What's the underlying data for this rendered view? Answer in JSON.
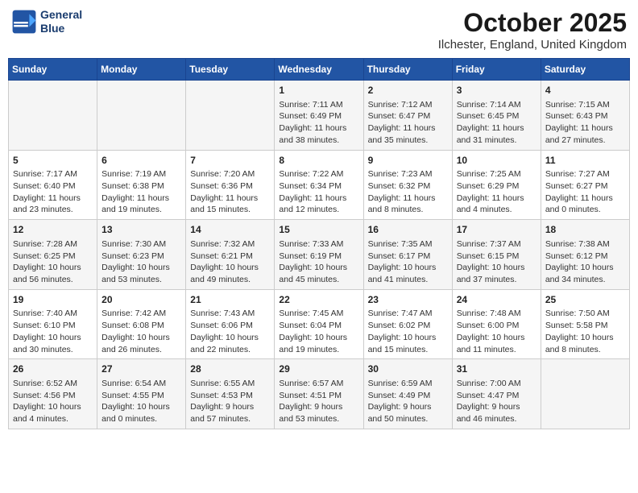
{
  "header": {
    "logo_line1": "General",
    "logo_line2": "Blue",
    "month": "October 2025",
    "location": "Ilchester, England, United Kingdom"
  },
  "weekdays": [
    "Sunday",
    "Monday",
    "Tuesday",
    "Wednesday",
    "Thursday",
    "Friday",
    "Saturday"
  ],
  "weeks": [
    [
      {
        "day": "",
        "content": ""
      },
      {
        "day": "",
        "content": ""
      },
      {
        "day": "",
        "content": ""
      },
      {
        "day": "1",
        "content": "Sunrise: 7:11 AM\nSunset: 6:49 PM\nDaylight: 11 hours\nand 38 minutes."
      },
      {
        "day": "2",
        "content": "Sunrise: 7:12 AM\nSunset: 6:47 PM\nDaylight: 11 hours\nand 35 minutes."
      },
      {
        "day": "3",
        "content": "Sunrise: 7:14 AM\nSunset: 6:45 PM\nDaylight: 11 hours\nand 31 minutes."
      },
      {
        "day": "4",
        "content": "Sunrise: 7:15 AM\nSunset: 6:43 PM\nDaylight: 11 hours\nand 27 minutes."
      }
    ],
    [
      {
        "day": "5",
        "content": "Sunrise: 7:17 AM\nSunset: 6:40 PM\nDaylight: 11 hours\nand 23 minutes."
      },
      {
        "day": "6",
        "content": "Sunrise: 7:19 AM\nSunset: 6:38 PM\nDaylight: 11 hours\nand 19 minutes."
      },
      {
        "day": "7",
        "content": "Sunrise: 7:20 AM\nSunset: 6:36 PM\nDaylight: 11 hours\nand 15 minutes."
      },
      {
        "day": "8",
        "content": "Sunrise: 7:22 AM\nSunset: 6:34 PM\nDaylight: 11 hours\nand 12 minutes."
      },
      {
        "day": "9",
        "content": "Sunrise: 7:23 AM\nSunset: 6:32 PM\nDaylight: 11 hours\nand 8 minutes."
      },
      {
        "day": "10",
        "content": "Sunrise: 7:25 AM\nSunset: 6:29 PM\nDaylight: 11 hours\nand 4 minutes."
      },
      {
        "day": "11",
        "content": "Sunrise: 7:27 AM\nSunset: 6:27 PM\nDaylight: 11 hours\nand 0 minutes."
      }
    ],
    [
      {
        "day": "12",
        "content": "Sunrise: 7:28 AM\nSunset: 6:25 PM\nDaylight: 10 hours\nand 56 minutes."
      },
      {
        "day": "13",
        "content": "Sunrise: 7:30 AM\nSunset: 6:23 PM\nDaylight: 10 hours\nand 53 minutes."
      },
      {
        "day": "14",
        "content": "Sunrise: 7:32 AM\nSunset: 6:21 PM\nDaylight: 10 hours\nand 49 minutes."
      },
      {
        "day": "15",
        "content": "Sunrise: 7:33 AM\nSunset: 6:19 PM\nDaylight: 10 hours\nand 45 minutes."
      },
      {
        "day": "16",
        "content": "Sunrise: 7:35 AM\nSunset: 6:17 PM\nDaylight: 10 hours\nand 41 minutes."
      },
      {
        "day": "17",
        "content": "Sunrise: 7:37 AM\nSunset: 6:15 PM\nDaylight: 10 hours\nand 37 minutes."
      },
      {
        "day": "18",
        "content": "Sunrise: 7:38 AM\nSunset: 6:12 PM\nDaylight: 10 hours\nand 34 minutes."
      }
    ],
    [
      {
        "day": "19",
        "content": "Sunrise: 7:40 AM\nSunset: 6:10 PM\nDaylight: 10 hours\nand 30 minutes."
      },
      {
        "day": "20",
        "content": "Sunrise: 7:42 AM\nSunset: 6:08 PM\nDaylight: 10 hours\nand 26 minutes."
      },
      {
        "day": "21",
        "content": "Sunrise: 7:43 AM\nSunset: 6:06 PM\nDaylight: 10 hours\nand 22 minutes."
      },
      {
        "day": "22",
        "content": "Sunrise: 7:45 AM\nSunset: 6:04 PM\nDaylight: 10 hours\nand 19 minutes."
      },
      {
        "day": "23",
        "content": "Sunrise: 7:47 AM\nSunset: 6:02 PM\nDaylight: 10 hours\nand 15 minutes."
      },
      {
        "day": "24",
        "content": "Sunrise: 7:48 AM\nSunset: 6:00 PM\nDaylight: 10 hours\nand 11 minutes."
      },
      {
        "day": "25",
        "content": "Sunrise: 7:50 AM\nSunset: 5:58 PM\nDaylight: 10 hours\nand 8 minutes."
      }
    ],
    [
      {
        "day": "26",
        "content": "Sunrise: 6:52 AM\nSunset: 4:56 PM\nDaylight: 10 hours\nand 4 minutes."
      },
      {
        "day": "27",
        "content": "Sunrise: 6:54 AM\nSunset: 4:55 PM\nDaylight: 10 hours\nand 0 minutes."
      },
      {
        "day": "28",
        "content": "Sunrise: 6:55 AM\nSunset: 4:53 PM\nDaylight: 9 hours\nand 57 minutes."
      },
      {
        "day": "29",
        "content": "Sunrise: 6:57 AM\nSunset: 4:51 PM\nDaylight: 9 hours\nand 53 minutes."
      },
      {
        "day": "30",
        "content": "Sunrise: 6:59 AM\nSunset: 4:49 PM\nDaylight: 9 hours\nand 50 minutes."
      },
      {
        "day": "31",
        "content": "Sunrise: 7:00 AM\nSunset: 4:47 PM\nDaylight: 9 hours\nand 46 minutes."
      },
      {
        "day": "",
        "content": ""
      }
    ]
  ]
}
